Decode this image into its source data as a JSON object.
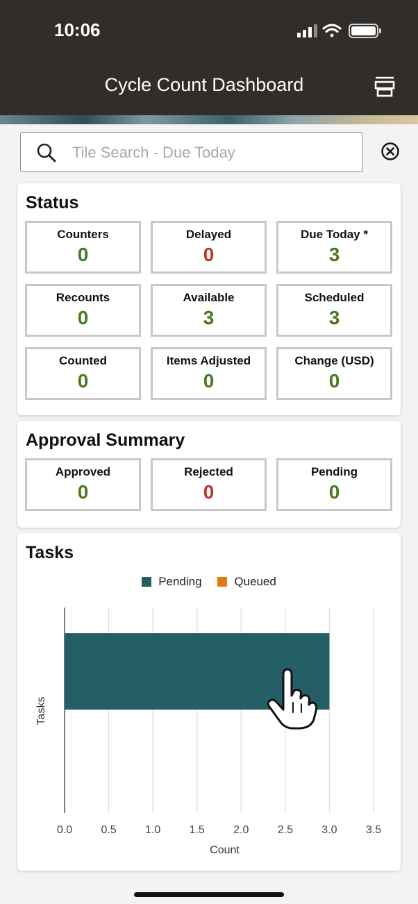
{
  "status_bar": {
    "time": "10:06"
  },
  "header": {
    "title": "Cycle Count Dashboard"
  },
  "search": {
    "placeholder": "Tile Search - Due Today"
  },
  "status_card": {
    "title": "Status",
    "tiles": [
      {
        "label": "Counters",
        "value": "0"
      },
      {
        "label": "Delayed",
        "value": "0"
      },
      {
        "label": "Due Today *",
        "value": "3"
      },
      {
        "label": "Recounts",
        "value": "0"
      },
      {
        "label": "Available",
        "value": "3"
      },
      {
        "label": "Scheduled",
        "value": "3"
      },
      {
        "label": "Counted",
        "value": "0"
      },
      {
        "label": "Items Adjusted",
        "value": "0"
      },
      {
        "label": "Change (USD)",
        "value": "0"
      }
    ]
  },
  "approval_card": {
    "title": "Approval Summary",
    "tiles": [
      {
        "label": "Approved",
        "value": "0"
      },
      {
        "label": "Rejected",
        "value": "0"
      },
      {
        "label": "Pending",
        "value": "0"
      }
    ]
  },
  "tasks_card": {
    "title": "Tasks"
  },
  "colors": {
    "pending": "#245e66",
    "queued": "#e07b18",
    "value_green": "#4a7a23",
    "value_red": "#b8382a"
  },
  "chart_data": {
    "type": "bar",
    "orientation": "horizontal",
    "categories": [
      ""
    ],
    "series": [
      {
        "name": "Pending",
        "values": [
          3
        ]
      },
      {
        "name": "Queued",
        "values": [
          0
        ]
      }
    ],
    "xlabel": "Count",
    "ylabel": "Tasks",
    "xlim": [
      0,
      3.5
    ],
    "xticks": [
      "0.0",
      "0.5",
      "1.0",
      "1.5",
      "2.0",
      "2.5",
      "3.0",
      "3.5"
    ],
    "grid": true,
    "legend": "top"
  }
}
